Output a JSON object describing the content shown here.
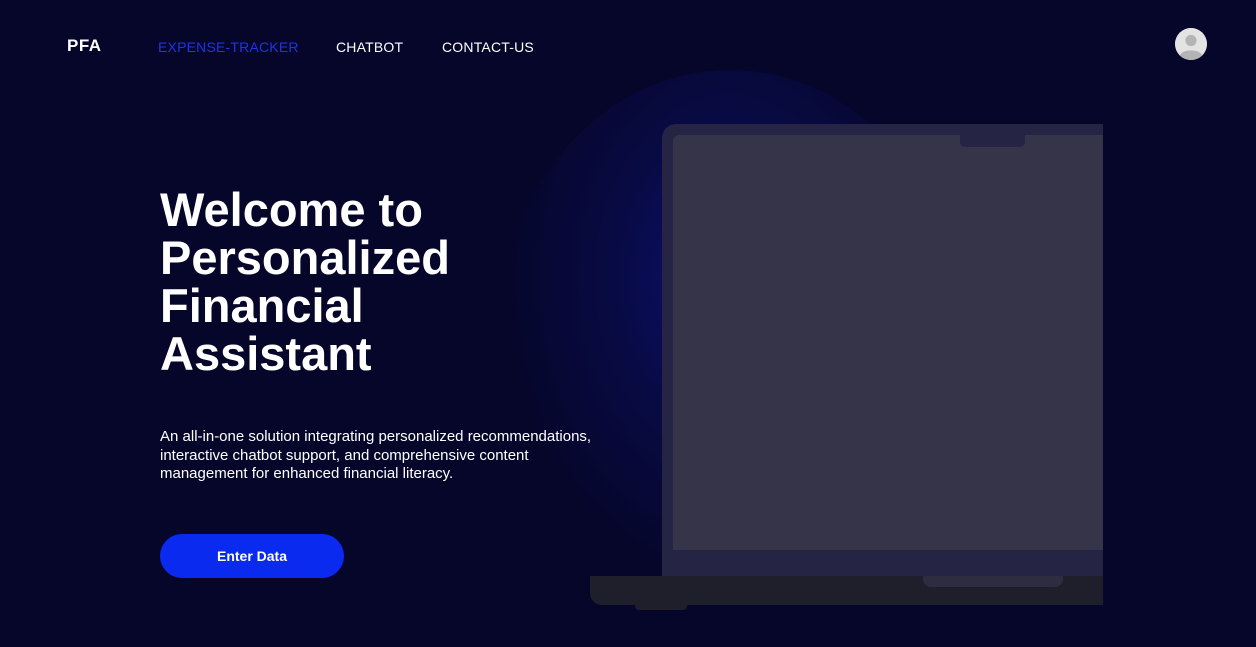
{
  "nav": {
    "logo": "PFA",
    "links": [
      {
        "label": "EXPENSE-TRACKER",
        "active": true
      },
      {
        "label": "CHATBOT",
        "active": false
      },
      {
        "label": "CONTACT-US",
        "active": false
      }
    ],
    "avatar_icon": "user-avatar-icon"
  },
  "hero": {
    "title_lines": [
      "Welcome to",
      "Personalized",
      "Financial",
      "Assistant"
    ],
    "description": "An all-in-one solution integrating personalized recommendations, interactive chatbot support, and comprehensive content management for enhanced financial literacy.",
    "cta_label": "Enter Data"
  },
  "colors": {
    "background": "#06062a",
    "accent": "#0a2af0",
    "active_link": "#1a35e8"
  }
}
